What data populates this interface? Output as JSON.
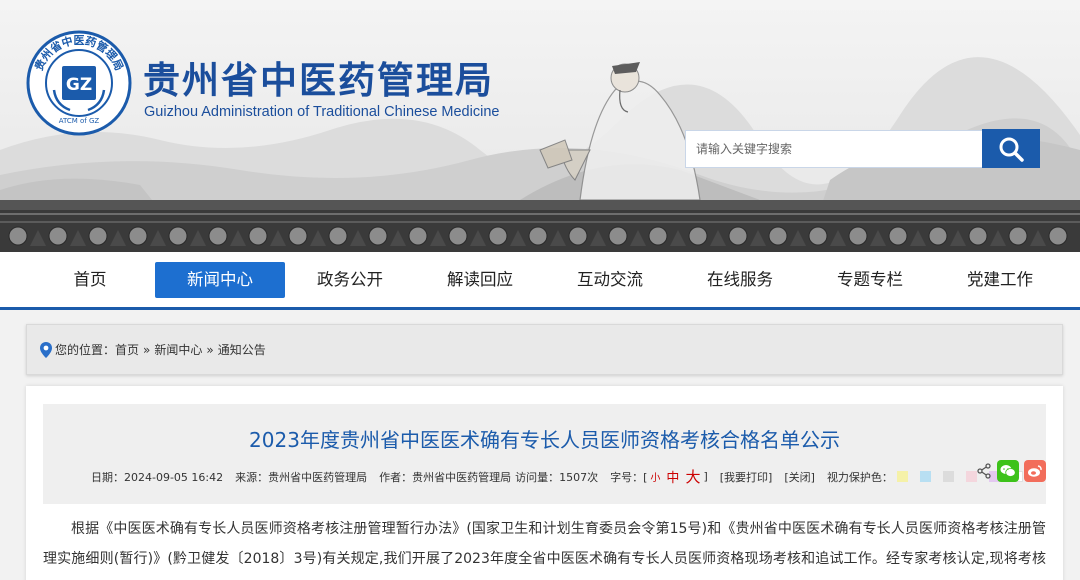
{
  "header": {
    "title": "贵州省中医药管理局",
    "subtitle": "Guizhou  Administration of Traditional Chinese Medicine",
    "seal_text": {
      "top": "贵州省中医药管理局",
      "bottom": "ATCM of GZ",
      "center": "GZ"
    },
    "search_placeholder": "请输入关键字搜索"
  },
  "nav": {
    "items": [
      {
        "label": "首页"
      },
      {
        "label": "新闻中心",
        "active": true
      },
      {
        "label": "政务公开"
      },
      {
        "label": "解读回应"
      },
      {
        "label": "互动交流"
      },
      {
        "label": "在线服务"
      },
      {
        "label": "专题专栏"
      },
      {
        "label": "党建工作"
      }
    ]
  },
  "breadcrumb": {
    "prefix": "您的位置：",
    "items": [
      "首页",
      "新闻中心",
      "通知公告"
    ],
    "separator": "»"
  },
  "article": {
    "title": "2023年度贵州省中医医术确有专长人员医师资格考核合格名单公示",
    "date": "日期：2024-09-05 16:42",
    "source": "来源：贵州省中医药管理局",
    "author": "作者：贵州省中医药管理局",
    "visits": "访问量：1507次",
    "font_label": "字号：[",
    "font_small": "小",
    "font_medium": "中",
    "font_large": "大",
    "font_close": "]",
    "print": "[我要打印]",
    "close": "[关闭]",
    "eye_label": "视力保护色：",
    "eye_colors": [
      "#f5f1a8",
      "#b8dff2",
      "#dcdcdc",
      "#f4d6dd",
      "#e3c8f0",
      "#ffffff"
    ],
    "body": "根据《中医医术确有专长人员医师资格考核注册管理暂行办法》(国家卫生和计划生育委员会令第15号)和《贵州省中医医术确有专长人员医师资格考核注册管理实施细则(暂行)》(黔卫健发〔2018〕3号)有关规定,我们开展了2023年度全省中医医术确有专长人员医师资格现场考核和追试工作。经专家考核认定,现将考核合"
  },
  "colors": {
    "brand_blue": "#1b5bab",
    "nav_active": "#1d6fd0",
    "wechat_green": "#3dc21a",
    "weibo_red": "#f26d5b"
  }
}
